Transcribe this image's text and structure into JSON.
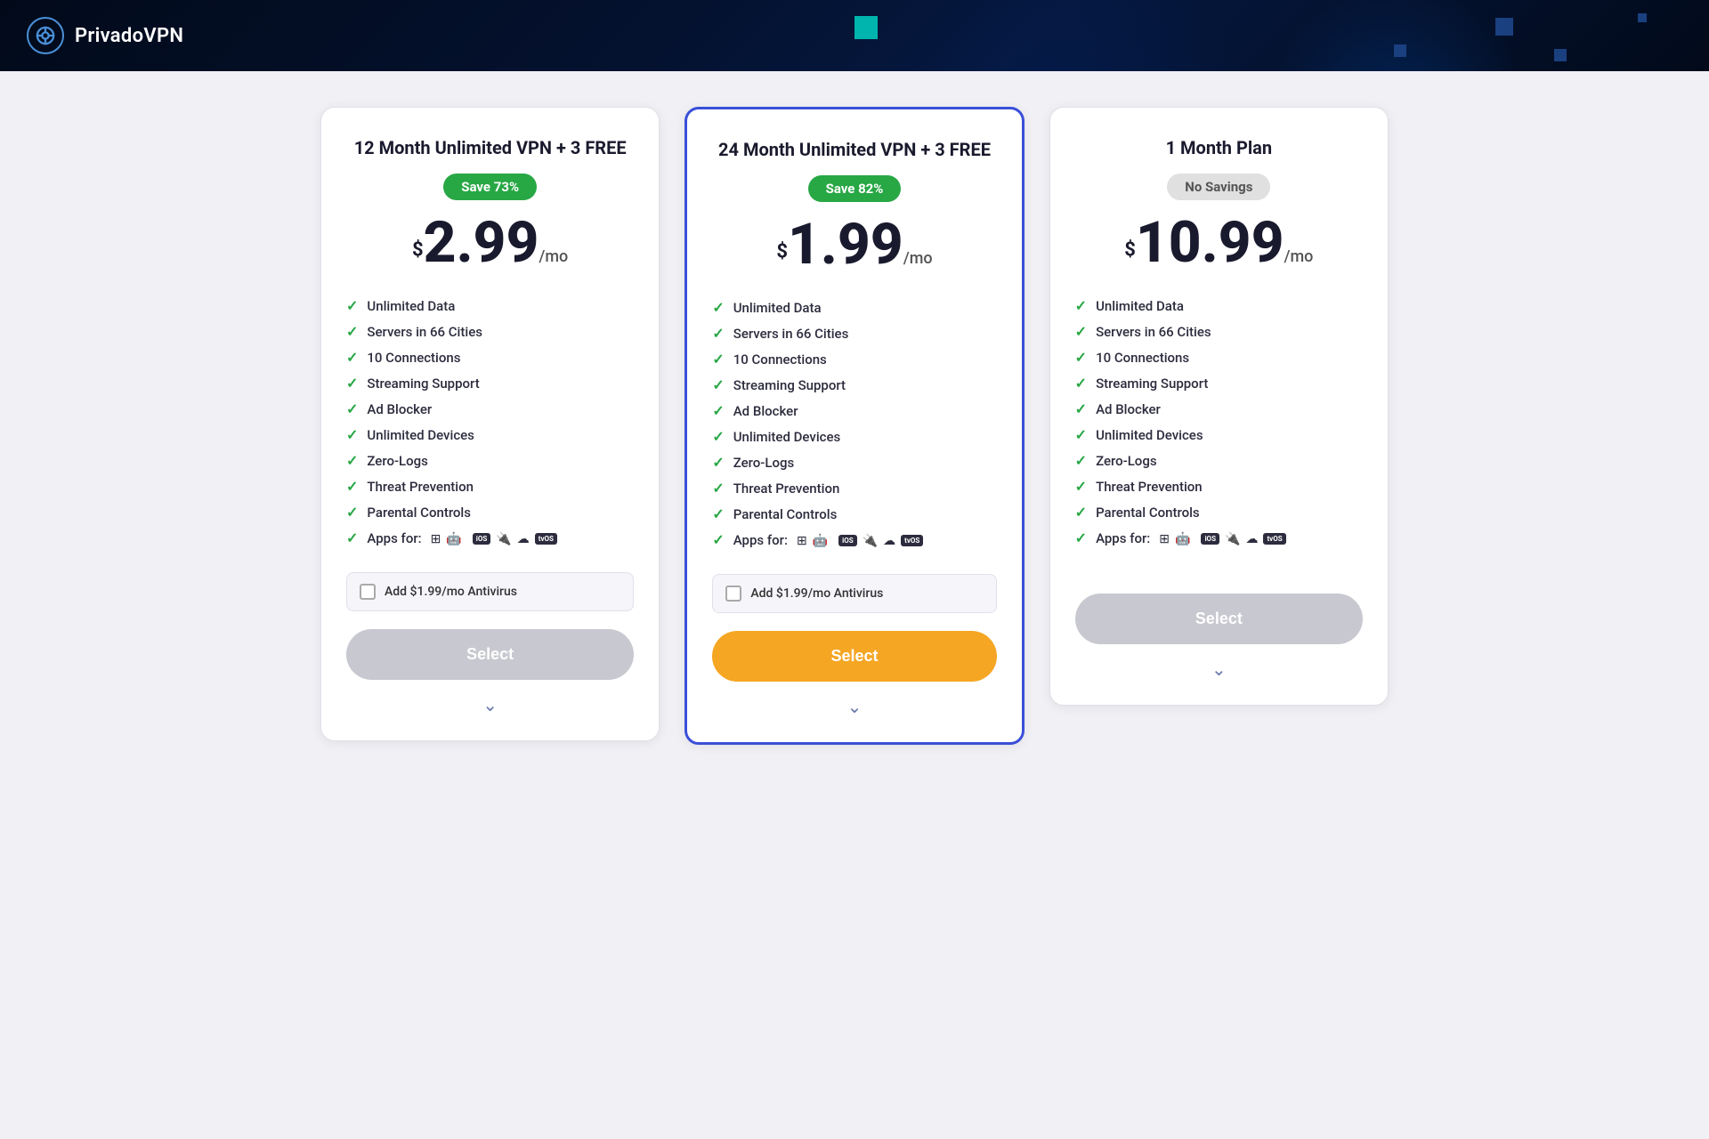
{
  "header": {
    "logo_text": "PrivadoVPN",
    "logo_icon_alt": "privado-vpn-logo"
  },
  "plans": [
    {
      "id": "plan-12month",
      "title": "12 Month Unlimited VPN + 3 FREE",
      "savings_badge": "Save 73%",
      "savings_type": "green",
      "price_dollar": "$",
      "price_amount": "2.99",
      "price_mo": "/mo",
      "featured": false,
      "features": [
        "Unlimited Data",
        "Servers in 66 Cities",
        "10 Connections",
        "Streaming Support",
        "Ad Blocker",
        "Unlimited Devices",
        "Zero-Logs",
        "Threat Prevention",
        "Parental Controls",
        "Apps for:"
      ],
      "antivirus_label": "Add $1.99/mo Antivirus",
      "select_label": "Select",
      "select_style": "grey-btn"
    },
    {
      "id": "plan-24month",
      "title": "24 Month Unlimited VPN + 3 FREE",
      "savings_badge": "Save 82%",
      "savings_type": "green",
      "price_dollar": "$",
      "price_amount": "1.99",
      "price_mo": "/mo",
      "featured": true,
      "features": [
        "Unlimited Data",
        "Servers in 66 Cities",
        "10 Connections",
        "Streaming Support",
        "Ad Blocker",
        "Unlimited Devices",
        "Zero-Logs",
        "Threat Prevention",
        "Parental Controls",
        "Apps for:"
      ],
      "antivirus_label": "Add $1.99/mo Antivirus",
      "select_label": "Select",
      "select_style": "orange-btn"
    },
    {
      "id": "plan-1month",
      "title": "1 Month Plan",
      "savings_badge": "No Savings",
      "savings_type": "grey",
      "price_dollar": "$",
      "price_amount": "10.99",
      "price_mo": "/mo",
      "featured": false,
      "features": [
        "Unlimited Data",
        "Servers in 66 Cities",
        "10 Connections",
        "Streaming Support",
        "Ad Blocker",
        "Unlimited Devices",
        "Zero-Logs",
        "Threat Prevention",
        "Parental Controls",
        "Apps for:"
      ],
      "antivirus_label": null,
      "select_label": "Select",
      "select_style": "grey-btn"
    }
  ]
}
